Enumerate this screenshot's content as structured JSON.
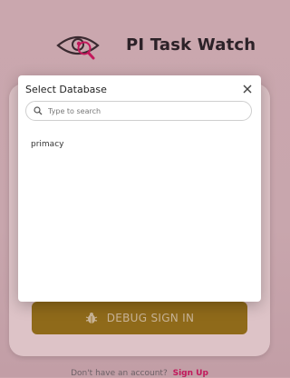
{
  "app": {
    "title": "PI Task Watch"
  },
  "login": {
    "debug_button_label": "DEBUG SIGN IN",
    "footer_text": "Don't have an account?",
    "signup_link": "Sign Up"
  },
  "modal": {
    "title": "Select Database",
    "search_placeholder": "Type to search",
    "search_value": "",
    "items": [
      {
        "label": "primacy"
      }
    ]
  },
  "colors": {
    "brand_accent": "#c2185b",
    "debug_button": "#8f6a1a",
    "background": "#caa7ae"
  },
  "icons": {
    "logo": "eye-magnifier-icon",
    "debug": "bug-icon",
    "close": "close-icon",
    "search": "search-icon"
  }
}
